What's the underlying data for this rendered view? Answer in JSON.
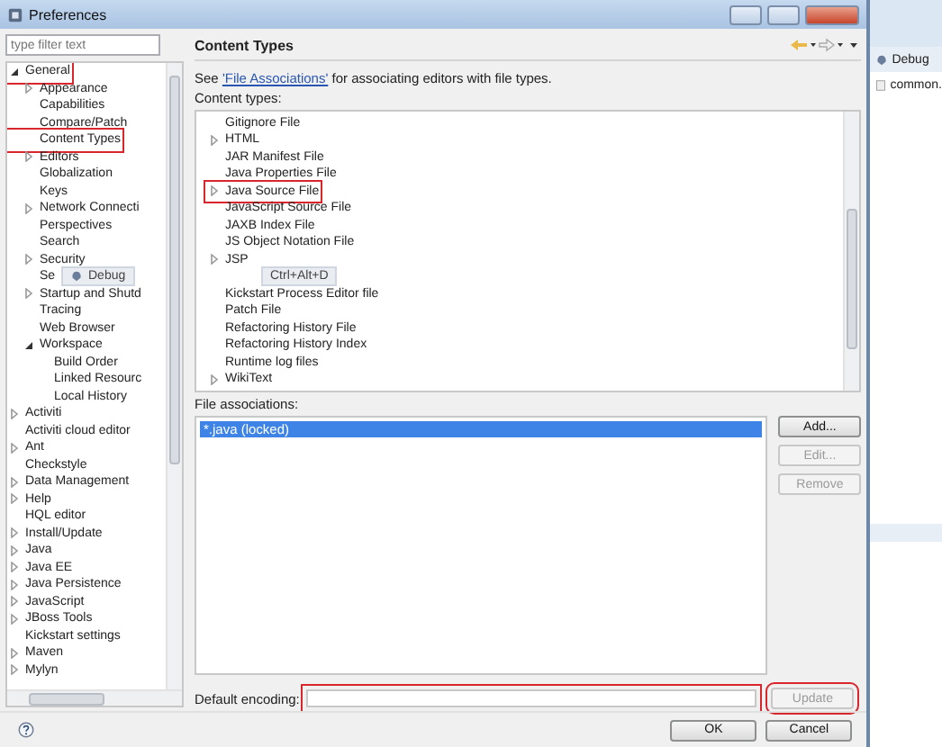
{
  "window": {
    "title": "Preferences"
  },
  "filter": {
    "placeholder": "type filter text"
  },
  "tree": [
    {
      "label": "General",
      "expanded": true,
      "annotated": true,
      "children": [
        {
          "label": "Appearance",
          "expanded": false
        },
        {
          "label": "Capabilities"
        },
        {
          "label": "Compare/Patch"
        },
        {
          "label": "Content Types",
          "annotated": true
        },
        {
          "label": "Editors",
          "expanded": false
        },
        {
          "label": "Globalization"
        },
        {
          "label": "Keys"
        },
        {
          "label": "Network Connecti",
          "expanded": false
        },
        {
          "label": "Perspectives"
        },
        {
          "label": "Search"
        },
        {
          "label": "Security",
          "expanded": false
        },
        {
          "label": "Se",
          "popup": "Debug"
        },
        {
          "label": "Startup and Shutd",
          "expanded": false
        },
        {
          "label": "Tracing"
        },
        {
          "label": "Web Browser"
        },
        {
          "label": "Workspace",
          "expanded": true,
          "children": [
            {
              "label": "Build Order"
            },
            {
              "label": "Linked Resourc"
            },
            {
              "label": "Local History"
            }
          ]
        }
      ]
    },
    {
      "label": "Activiti",
      "expanded": false
    },
    {
      "label": "Activiti cloud editor"
    },
    {
      "label": "Ant",
      "expanded": false
    },
    {
      "label": "Checkstyle"
    },
    {
      "label": "Data Management",
      "expanded": false
    },
    {
      "label": "Help",
      "expanded": false
    },
    {
      "label": "HQL editor"
    },
    {
      "label": "Install/Update",
      "expanded": false
    },
    {
      "label": "Java",
      "expanded": false
    },
    {
      "label": "Java EE",
      "expanded": false
    },
    {
      "label": "Java Persistence",
      "expanded": false
    },
    {
      "label": "JavaScript",
      "expanded": false
    },
    {
      "label": "JBoss Tools",
      "expanded": false
    },
    {
      "label": "Kickstart settings"
    },
    {
      "label": "Maven",
      "expanded": false
    },
    {
      "label": "Mylyn",
      "expanded": false
    }
  ],
  "page": {
    "title": "Content Types",
    "description_parts": {
      "before": "See ",
      "link": "'File Associations'",
      "after": " for associating editors with file types."
    },
    "content_types_label": "Content types:",
    "content_types": [
      {
        "kind": "item",
        "label": "Gitignore File"
      },
      {
        "kind": "item",
        "label": "HTML",
        "expanded": false
      },
      {
        "kind": "item",
        "label": "JAR Manifest File"
      },
      {
        "kind": "item",
        "label": "Java Properties File"
      },
      {
        "kind": "item",
        "label": "Java Source File",
        "expanded": false,
        "annotated": true
      },
      {
        "kind": "item",
        "label": "JavaScript Source File"
      },
      {
        "kind": "item",
        "label": "JAXB Index File"
      },
      {
        "kind": "item",
        "label": "JS Object Notation File"
      },
      {
        "kind": "item",
        "label": "JSP",
        "expanded": false
      },
      {
        "kind": "popup",
        "shortcut": "Ctrl+Alt+D"
      },
      {
        "kind": "item",
        "label": "Kickstart Process Editor file"
      },
      {
        "kind": "item",
        "label": "Patch File"
      },
      {
        "kind": "item",
        "label": "Refactoring History File"
      },
      {
        "kind": "item",
        "label": "Refactoring History Index"
      },
      {
        "kind": "item",
        "label": "Runtime log files"
      },
      {
        "kind": "item",
        "label": "WikiText",
        "expanded": false
      }
    ],
    "file_associations_label": "File associations:",
    "file_associations": [
      {
        "label": "*.java (locked)",
        "selected": true
      }
    ],
    "buttons": [
      {
        "label": "Add...",
        "disabled": false
      },
      {
        "label": "Edit...",
        "disabled": true
      },
      {
        "label": "Remove",
        "disabled": true
      }
    ],
    "encoding": {
      "label": "Default encoding:",
      "annotated": true
    },
    "update": {
      "label": "Update",
      "disabled": true,
      "annotated": true
    }
  },
  "footer": {
    "buttons": [
      "OK",
      "Cancel"
    ]
  },
  "background": {
    "tab": "Debug",
    "file": "common."
  }
}
